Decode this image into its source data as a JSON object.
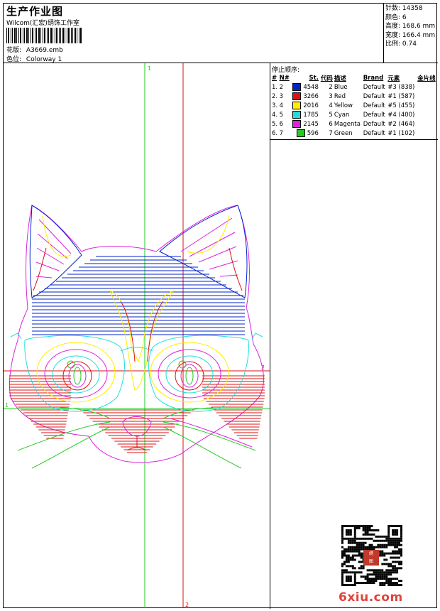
{
  "header": {
    "title": "生产作业图",
    "company": "Wilcom(汇宏)绣饰工作室",
    "design_label": "花版:",
    "design_value": "A3669.emb",
    "colorway_label": "色位:",
    "colorway_value": "Colorway 1"
  },
  "stats": {
    "stitches_label": "针数:",
    "stitches": "14358",
    "colors_label": "颜色:",
    "colors": "6",
    "height_label": "高度:",
    "height": "168.6 mm",
    "width_label": "宽度:",
    "width": "166.4 mm",
    "scale_label": "比例:",
    "scale": "0.74"
  },
  "sequence": {
    "title": "停止顺序:",
    "columns": [
      "#",
      "N#",
      "St.",
      "代码",
      "描述",
      "Brand",
      "元素",
      "金片线"
    ],
    "rows": [
      {
        "num": "1.",
        "n": "2",
        "color": "#0022cc",
        "st": "4548",
        "code": "2",
        "desc": "Blue",
        "brand": "Default",
        "element": "#3 (838)"
      },
      {
        "num": "2.",
        "n": "3",
        "color": "#dd1111",
        "st": "3266",
        "code": "3",
        "desc": "Red",
        "brand": "Default",
        "element": "#1 (587)"
      },
      {
        "num": "3.",
        "n": "4",
        "color": "#ffee00",
        "st": "2016",
        "code": "4",
        "desc": "Yellow",
        "brand": "Default",
        "element": "#5 (455)"
      },
      {
        "num": "4.",
        "n": "5",
        "color": "#22dddd",
        "st": "1785",
        "code": "5",
        "desc": "Cyan",
        "brand": "Default",
        "element": "#4 (400)"
      },
      {
        "num": "5.",
        "n": "6",
        "color": "#dd22dd",
        "st": "2145",
        "code": "6",
        "desc": "Magenta",
        "brand": "Default",
        "element": "#2 (464)"
      },
      {
        "num": "6.",
        "n": "7",
        "color": "#22cc22",
        "st": "596",
        "code": "7",
        "desc": "Green",
        "brand": "Default",
        "element": "#1 (102)"
      }
    ]
  },
  "canvas": {
    "marker_1_top": "1",
    "marker_1_left": "1",
    "marker_2_right": "2",
    "marker_2_bottom": "2"
  },
  "watermark": {
    "site": "6xiu.com"
  }
}
